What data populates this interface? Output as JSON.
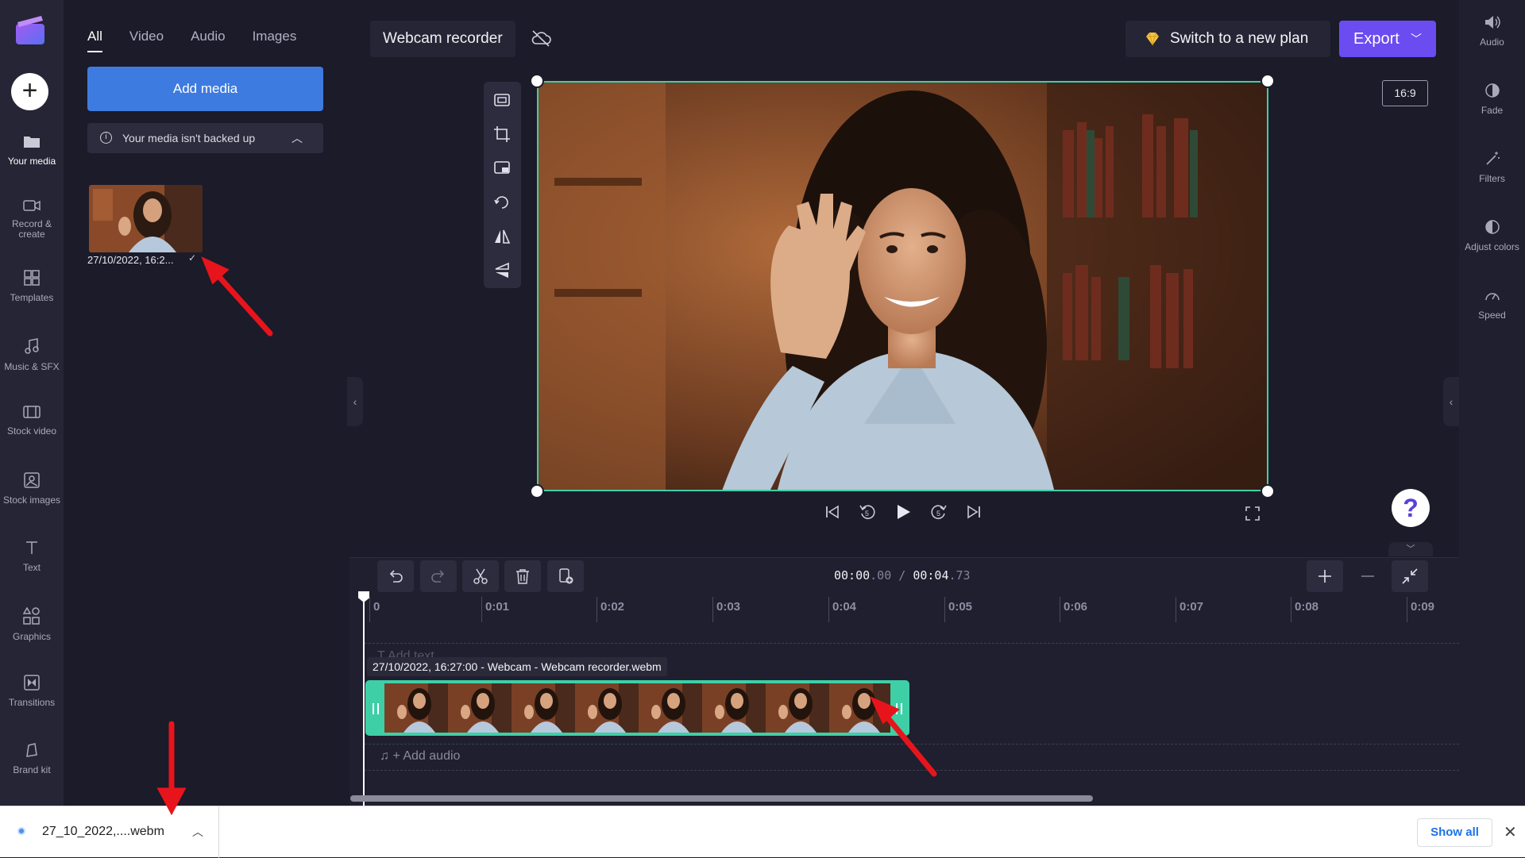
{
  "left_rail": {
    "items": [
      {
        "label": "Your media",
        "icon": "folder-icon"
      },
      {
        "label": "Record &\ncreate",
        "icon": "camera-icon"
      },
      {
        "label": "Templates",
        "icon": "templates-icon"
      },
      {
        "label": "Music & SFX",
        "icon": "music-icon"
      },
      {
        "label": "Stock video",
        "icon": "film-icon"
      },
      {
        "label": "Stock images",
        "icon": "image-icon"
      },
      {
        "label": "Text",
        "icon": "text-icon"
      },
      {
        "label": "Graphics",
        "icon": "shapes-icon"
      },
      {
        "label": "Transitions",
        "icon": "transitions-icon"
      },
      {
        "label": "Brand kit",
        "icon": "brand-icon"
      }
    ]
  },
  "media_panel": {
    "tabs": [
      "All",
      "Video",
      "Audio",
      "Images"
    ],
    "active_tab": "All",
    "add_media_label": "Add media",
    "backup_notice": "Your media isn't backed up",
    "media_item_label": "27/10/2022, 16:2..."
  },
  "topbar": {
    "project_title": "Webcam recorder",
    "upgrade_label": "Switch to a new plan",
    "export_label": "Export",
    "aspect_ratio": "16:9"
  },
  "right_rail": {
    "items": [
      {
        "label": "Audio",
        "icon": "speaker-icon"
      },
      {
        "label": "Fade",
        "icon": "fade-icon"
      },
      {
        "label": "Filters",
        "icon": "wand-icon"
      },
      {
        "label": "Adjust colors",
        "icon": "contrast-icon"
      },
      {
        "label": "Speed",
        "icon": "speedometer-icon"
      }
    ]
  },
  "timeline": {
    "time_current": "00:00",
    "time_current_frac": ".00",
    "time_separator": "/",
    "time_total": "00:04",
    "time_total_frac": ".73",
    "ruler_labels": [
      "0",
      "0:01",
      "0:02",
      "0:03",
      "0:04",
      "0:05",
      "0:06",
      "0:07",
      "0:08",
      "0:09"
    ],
    "add_text_label": "T  Add text",
    "clip_label": "27/10/2022, 16:27:00 - Webcam - Webcam recorder.webm",
    "add_audio_label": "+ Add audio"
  },
  "download_bar": {
    "file_name": "27_10_2022,....webm",
    "show_all_label": "Show all",
    "close_label": "✕"
  },
  "colors": {
    "accent_blue": "#3e7be0",
    "export_purple": "#6a4cf0",
    "selection_green": "#3ecfa6",
    "annotation_red": "#e8141c"
  }
}
